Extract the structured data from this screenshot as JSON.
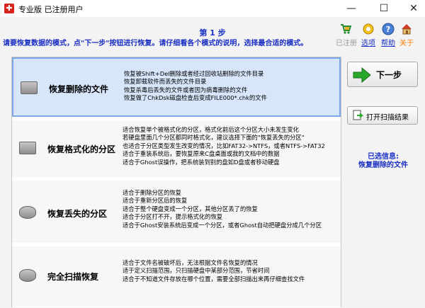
{
  "window": {
    "title": "专业版   已注册用户",
    "minimize": "—",
    "maximize": "☐",
    "close": "✕"
  },
  "header": {
    "step": "第 1 步",
    "instruction": "请要恢复数据的模式，点\"下一步\"按钮进行恢复。请仔细看各个模式的说明，选择最合适的模式。"
  },
  "tools": [
    {
      "label": "已注册",
      "icon": "cart-icon",
      "color": "#9a9a9a"
    },
    {
      "label": "选项",
      "icon": "gear-icon",
      "color": "#1a2fc4"
    },
    {
      "label": "帮助",
      "icon": "help-icon",
      "color": "#1a2fc4"
    },
    {
      "label": "关于",
      "icon": "house-icon",
      "color": "#ff7a00"
    }
  ],
  "modes": [
    {
      "name": "恢复删除的文件",
      "icon": "hard-drive-icon",
      "selected": true,
      "desc": [
        "恢复被Shift+Del删除或者经过回收站删除的文件目录",
        "恢复卸载软件而丢失的文件目录",
        "恢复杀毒后丢失的文件或者因为病毒删除的文件",
        "恢复做了ChkDsk磁盘检查后变成FILE000*.chk的文件"
      ]
    },
    {
      "name": "恢复格式化的分区",
      "icon": "hard-drive-icon",
      "selected": false,
      "desc": [
        "适合恢复单个被格式化的分区，格式化前后这个分区大小未发生变化",
        "若硬盘里面几个分区都同时格式化，建议选择下面的\"恢复丢失的分区\"",
        "也适合于分区类型发生改变的情况，比如FAT32->NTFS，或者NTFS->FAT32",
        "适合于重装系统后，要恢复原来C盘桌面或我的文档中的数据",
        "适合于Ghost误操作，把系统装到别的盘如D盘或者移动硬盘"
      ]
    },
    {
      "name": "恢复丢失的分区",
      "icon": "disk-platter-icon",
      "selected": false,
      "desc": [
        "适合于删除分区的恢复",
        "适合于重新分区后的恢复",
        "适合于整个硬盘变成一个分区，其他分区丢了的恢复",
        "适合于分区打不开，提示格式化的恢复",
        "适合于Ghost安装系统后变成一个分区，或者Ghost自动把硬盘分成几个分区"
      ]
    },
    {
      "name": "完全扫描恢复",
      "icon": "disk-platter-icon",
      "selected": false,
      "desc": [
        "适合于文件名被破坏后，无法根据文件名恢复的情况",
        "适于定义扫描范围，只扫描硬盘中某部分范围，节省时间",
        "适合于不知道文件存放在哪个位置，需要全部扫描出来再仔细查找文件"
      ]
    }
  ],
  "sidebar": {
    "next_label": "下一步",
    "open_label": "打开扫描结果",
    "selected_info_title": "已选信息:",
    "selected_info_value": "恢复删除的文件"
  }
}
